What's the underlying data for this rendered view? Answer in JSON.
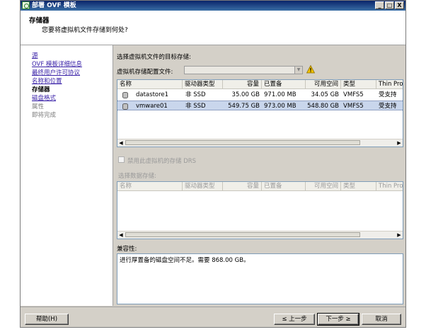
{
  "window": {
    "title": "部署 OVF 模板",
    "minimize_label": "_",
    "maximize_label": "□",
    "close_label": "X"
  },
  "header": {
    "title": "存储器",
    "subtitle": "您要将虚拟机文件存储到何处?"
  },
  "nav": {
    "items": [
      {
        "label": "源",
        "state": "link"
      },
      {
        "label": "OVF 模板详细信息",
        "state": "link"
      },
      {
        "label": "最终用户许可协议",
        "state": "link"
      },
      {
        "label": "名称和位置",
        "state": "link"
      },
      {
        "label": "存储器",
        "state": "current"
      },
      {
        "label": "磁盘格式",
        "state": "link"
      },
      {
        "label": "属性",
        "state": "disabled"
      },
      {
        "label": "即将完成",
        "state": "disabled"
      }
    ]
  },
  "storage": {
    "section_label": "选择虚拟机文件的目标存储:",
    "profile_label": "虚拟机存储配置文件:",
    "profile_value": "",
    "columns": [
      "名称",
      "驱动器类型",
      "容量",
      "已置备",
      "可用空间",
      "类型",
      "Thin Provi"
    ],
    "rows": [
      {
        "name": "datastore1",
        "drive": "非 SSD",
        "capacity": "35.00 GB",
        "provisioned": "971.00 MB",
        "free": "34.05 GB",
        "type": "VMFS5",
        "thin": "受支持",
        "selected": false
      },
      {
        "name": "vmware01",
        "drive": "非 SSD",
        "capacity": "549.75 GB",
        "provisioned": "973.00 MB",
        "free": "548.80 GB",
        "type": "VMFS5",
        "thin": "受支持",
        "selected": true
      }
    ]
  },
  "drs": {
    "checkbox_label": "禁用此虚拟机的存储 DRS"
  },
  "datastores": {
    "section_label": "选择数据存储:",
    "columns": [
      "名称",
      "驱动器类型",
      "容量",
      "已置备",
      "可用空间",
      "类型",
      "Thin Provi"
    ]
  },
  "compatibility": {
    "label": "兼容性:",
    "message": "进行厚置备的磁盘空间不足。需要 868.00 GB。"
  },
  "footer": {
    "help_label": "帮助(H)",
    "back_label": "≤ 上一步",
    "next_label": "下一步 ≥",
    "cancel_label": "取消"
  },
  "colors": {
    "titlebar": "#0a246a",
    "link": "#3a22a8",
    "selection": "#c9d6ec",
    "warning": "#f2c200"
  }
}
